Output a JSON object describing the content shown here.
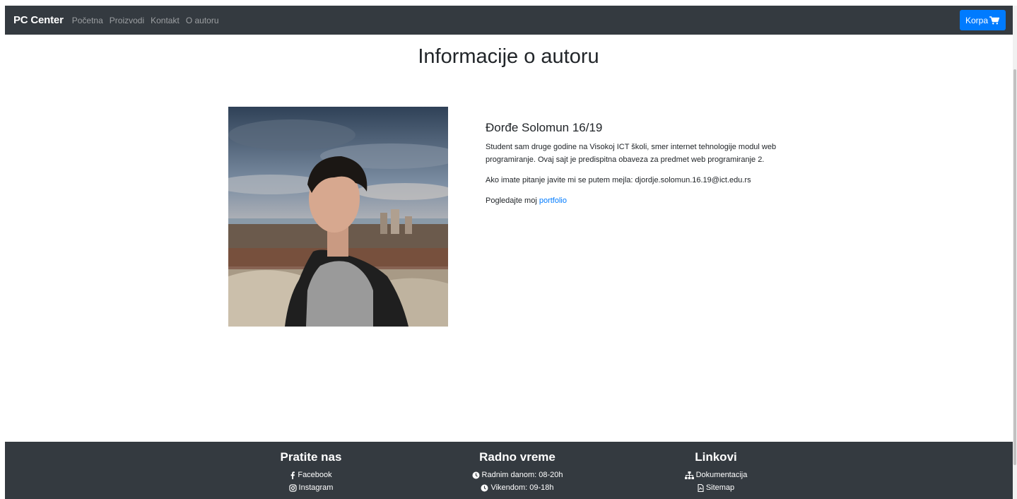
{
  "navbar": {
    "brand": "PC Center",
    "links": [
      "Početna",
      "Proizvodi",
      "Kontakt",
      "O autoru"
    ],
    "cart_label": "Korpa",
    "cart_icon": "cart-icon",
    "bg_color": "#343a40",
    "cart_color": "#007bff"
  },
  "main": {
    "title": "Informacije o autoru",
    "author_name": "Đorđe Solomun 16/19",
    "bio": "Student sam druge godine na Visokoj ICT školi, smer internet tehnologije modul web programiranje. Ovaj sajt je predispitna obaveza za predmet web programiranje 2.",
    "contact": "Ako imate pitanje javite mi se putem mejla: djordje.solomun.16.19@ict.edu.rs",
    "portfolio_prefix": "Pogledajte moj",
    "portfolio_link": "portfolio"
  },
  "footer": {
    "follow": {
      "title": "Pratite nas",
      "items": [
        {
          "icon": "facebook-icon",
          "label": "Facebook"
        },
        {
          "icon": "instagram-icon",
          "label": "Instagram"
        }
      ]
    },
    "hours": {
      "title": "Radno vreme",
      "items": [
        {
          "icon": "clock-icon",
          "label": "Radnim danom: 08-20h"
        },
        {
          "icon": "clock-icon",
          "label": "Vikendom: 09-18h"
        }
      ]
    },
    "links": {
      "title": "Linkovi",
      "items": [
        {
          "icon": "sitemap-icon",
          "label": "Dokumentacija"
        },
        {
          "icon": "file-icon",
          "label": "Sitemap"
        }
      ]
    }
  }
}
